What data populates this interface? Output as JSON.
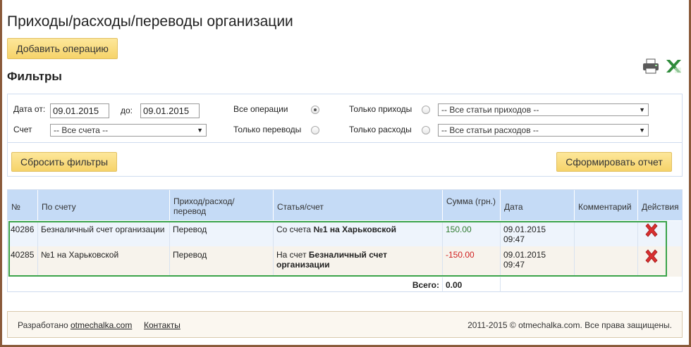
{
  "page": {
    "title": "Приходы/расходы/переводы организации",
    "add_button": "Добавить операцию",
    "filters_title": "Фильтры"
  },
  "export": {
    "print_icon": "printer-icon",
    "excel_icon": "excel-icon"
  },
  "filters": {
    "date_from_label": "Дата от:",
    "date_from_value": "09.01.2015",
    "date_to_label": "до:",
    "date_to_value": "09.01.2015",
    "account_label": "Счет",
    "account_select": "-- Все счета --",
    "radio_all": "Все операции",
    "radio_transfers": "Только переводы",
    "radio_income": "Только приходы",
    "radio_expense": "Только расходы",
    "income_select": "-- Все статьи приходов --",
    "expense_select": "-- Все статьи расходов --",
    "selected_radio": "all",
    "reset_button": "Сбросить фильтры",
    "report_button": "Сформировать отчет"
  },
  "table": {
    "headers": {
      "num": "№",
      "account": "По счету",
      "type": "Приход/расход/ перевод",
      "article": "Статья/счет",
      "sum": "Сумма (грн.)",
      "date": "Дата",
      "comment": "Комментарий",
      "actions": "Действия"
    },
    "rows": [
      {
        "num": "40286",
        "account": "Безналичный счет организации",
        "type": "Перевод",
        "article_prefix": "Со счета",
        "article_name": "№1 на Харьковской",
        "sum": "150.00",
        "date": "09.01.2015",
        "time": "09:47",
        "comment": ""
      },
      {
        "num": "40285",
        "account": "№1 на Харьковской",
        "type": "Перевод",
        "article_prefix": "На счет",
        "article_name": "Безналичный счет организации",
        "sum": "-150.00",
        "date": "09.01.2015",
        "time": "09:47",
        "comment": ""
      }
    ],
    "total_label": "Всего:",
    "total_value": "0.00"
  },
  "footer": {
    "developed_by": "Разработано",
    "developer_link": "otmechalka.com",
    "contacts_link": "Контакты",
    "copyright": "2011-2015 © otmechalka.com. Все права защищены."
  },
  "colors": {
    "accent_button": "#f6d36a",
    "table_header": "#c5dbf6",
    "positive": "#2f7a2f",
    "negative": "#d02020"
  }
}
